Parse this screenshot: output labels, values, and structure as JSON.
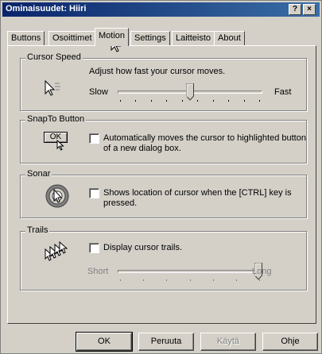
{
  "window": {
    "title": "Ominaisuudet: Hiiri",
    "help_btn": "?",
    "close_btn": "×"
  },
  "tabs": [
    {
      "label": "Buttons"
    },
    {
      "label": "Osoittimet"
    },
    {
      "label": "Motion",
      "active": true
    },
    {
      "label": "Settings"
    },
    {
      "label": "Laitteisto"
    },
    {
      "label": "About"
    }
  ],
  "cursor_speed": {
    "legend": "Cursor Speed",
    "description": "Adjust how fast your cursor moves.",
    "slow_label": "Slow",
    "fast_label": "Fast",
    "value_fraction": 0.5
  },
  "snapto": {
    "legend": "SnapTo Button",
    "button_caption": "OK",
    "checkbox_text_1": "Automatically moves the cursor to highlighted button",
    "checkbox_text_2": "of a new dialog box.",
    "checked": false
  },
  "sonar": {
    "legend": "Sonar",
    "checkbox_text_1": "Shows location of cursor when the [CTRL] key is",
    "checkbox_text_2": "pressed.",
    "checked": false
  },
  "trails": {
    "legend": "Trails",
    "checkbox_text": "Display cursor trails.",
    "short_label": "Short",
    "long_label": "Long",
    "checked": false,
    "value_fraction": 1.0
  },
  "buttons": {
    "ok": "OK",
    "cancel": "Peruuta",
    "apply": "Käytä",
    "help": "Ohje"
  }
}
